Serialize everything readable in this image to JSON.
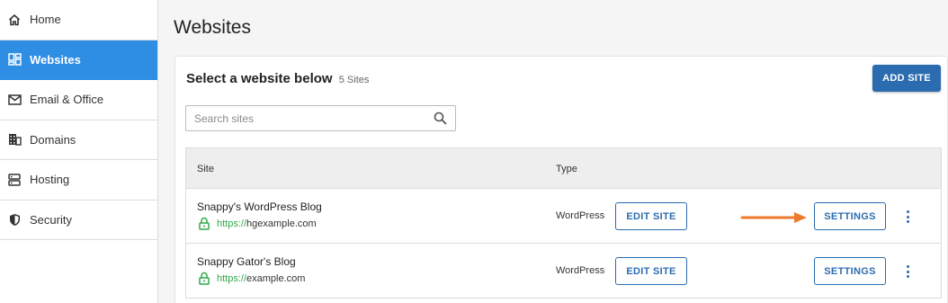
{
  "sidebar": {
    "items": [
      {
        "label": "Home",
        "icon": "home-icon"
      },
      {
        "label": "Websites",
        "icon": "dashboard-icon",
        "active": true
      },
      {
        "label": "Email & Office",
        "icon": "mail-icon"
      },
      {
        "label": "Domains",
        "icon": "building-icon"
      },
      {
        "label": "Hosting",
        "icon": "server-icon"
      },
      {
        "label": "Security",
        "icon": "shield-icon"
      }
    ]
  },
  "page": {
    "title": "Websites"
  },
  "card": {
    "title": "Select a website below",
    "count": "5 Sites",
    "add_label": "ADD SITE"
  },
  "search": {
    "placeholder": "Search sites",
    "value": ""
  },
  "table": {
    "headers": {
      "site": "Site",
      "type": "Type"
    },
    "rows": [
      {
        "name": "Snappy's WordPress Blog",
        "url_protocol": "https://",
        "url_domain": "hgexample.com",
        "type": "WordPress",
        "edit_label": "EDIT SITE",
        "settings_label": "SETTINGS"
      },
      {
        "name": "Snappy Gator's Blog",
        "url_protocol": "https://",
        "url_domain": "example.com",
        "type": "WordPress",
        "edit_label": "EDIT SITE",
        "settings_label": "SETTINGS"
      }
    ]
  },
  "colors": {
    "accent": "#2e8ee3",
    "button": "#2b6cb0",
    "secure": "#2ea84a",
    "annotation_arrow": "#f07a2c"
  }
}
